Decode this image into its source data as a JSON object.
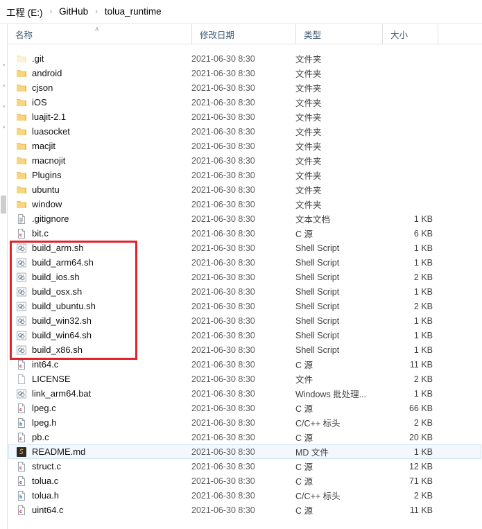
{
  "window": {
    "app": "windows-file-explorer",
    "accent_selection": "#f2f8fd",
    "annotation_color": "#e0232b"
  },
  "breadcrumb": {
    "name": "address-breadcrumb",
    "separator": "›",
    "items": [
      {
        "label": "工程 (E:)"
      },
      {
        "label": "GitHub"
      },
      {
        "label": "tolua_runtime"
      }
    ]
  },
  "columns": {
    "name": "名称",
    "date_modified": "修改日期",
    "type": "类型",
    "size": "大小",
    "sort_indicator": "∧",
    "sort_column": "名称",
    "sort_direction": "ascending"
  },
  "annotation": {
    "shape": "rectangle",
    "color": "#e0232b",
    "targets": [
      "build_arm.sh",
      "build_arm64.sh",
      "build_ios.sh",
      "build_osx.sh",
      "build_ubuntu.sh",
      "build_win32.sh",
      "build_win64.sh",
      "build_x86.sh"
    ]
  },
  "files": [
    {
      "name": ".git",
      "date": "2021-06-30 8:30",
      "type": "文件夹",
      "size": "",
      "icon": "folder-faded-icon",
      "selected": false
    },
    {
      "name": "android",
      "date": "2021-06-30 8:30",
      "type": "文件夹",
      "size": "",
      "icon": "folder-icon",
      "selected": false
    },
    {
      "name": "cjson",
      "date": "2021-06-30 8:30",
      "type": "文件夹",
      "size": "",
      "icon": "folder-icon",
      "selected": false
    },
    {
      "name": "iOS",
      "date": "2021-06-30 8:30",
      "type": "文件夹",
      "size": "",
      "icon": "folder-icon",
      "selected": false
    },
    {
      "name": "luajit-2.1",
      "date": "2021-06-30 8:30",
      "type": "文件夹",
      "size": "",
      "icon": "folder-icon",
      "selected": false
    },
    {
      "name": "luasocket",
      "date": "2021-06-30 8:30",
      "type": "文件夹",
      "size": "",
      "icon": "folder-icon",
      "selected": false
    },
    {
      "name": "macjit",
      "date": "2021-06-30 8:30",
      "type": "文件夹",
      "size": "",
      "icon": "folder-icon",
      "selected": false
    },
    {
      "name": "macnojit",
      "date": "2021-06-30 8:30",
      "type": "文件夹",
      "size": "",
      "icon": "folder-icon",
      "selected": false
    },
    {
      "name": "Plugins",
      "date": "2021-06-30 8:30",
      "type": "文件夹",
      "size": "",
      "icon": "folder-icon",
      "selected": false
    },
    {
      "name": "ubuntu",
      "date": "2021-06-30 8:30",
      "type": "文件夹",
      "size": "",
      "icon": "folder-icon",
      "selected": false
    },
    {
      "name": "window",
      "date": "2021-06-30 8:30",
      "type": "文件夹",
      "size": "",
      "icon": "folder-icon",
      "selected": false
    },
    {
      "name": ".gitignore",
      "date": "2021-06-30 8:30",
      "type": "文本文档",
      "size": "1 KB",
      "icon": "text-document-icon",
      "selected": false
    },
    {
      "name": "bit.c",
      "date": "2021-06-30 8:30",
      "type": "C 源",
      "size": "6 KB",
      "icon": "c-source-icon",
      "selected": false
    },
    {
      "name": "build_arm.sh",
      "date": "2021-06-30 8:30",
      "type": "Shell Script",
      "size": "1 KB",
      "icon": "shell-script-icon",
      "selected": false
    },
    {
      "name": "build_arm64.sh",
      "date": "2021-06-30 8:30",
      "type": "Shell Script",
      "size": "1 KB",
      "icon": "shell-script-icon",
      "selected": false
    },
    {
      "name": "build_ios.sh",
      "date": "2021-06-30 8:30",
      "type": "Shell Script",
      "size": "2 KB",
      "icon": "shell-script-icon",
      "selected": false
    },
    {
      "name": "build_osx.sh",
      "date": "2021-06-30 8:30",
      "type": "Shell Script",
      "size": "1 KB",
      "icon": "shell-script-icon",
      "selected": false
    },
    {
      "name": "build_ubuntu.sh",
      "date": "2021-06-30 8:30",
      "type": "Shell Script",
      "size": "2 KB",
      "icon": "shell-script-icon",
      "selected": false
    },
    {
      "name": "build_win32.sh",
      "date": "2021-06-30 8:30",
      "type": "Shell Script",
      "size": "1 KB",
      "icon": "shell-script-icon",
      "selected": false
    },
    {
      "name": "build_win64.sh",
      "date": "2021-06-30 8:30",
      "type": "Shell Script",
      "size": "1 KB",
      "icon": "shell-script-icon",
      "selected": false
    },
    {
      "name": "build_x86.sh",
      "date": "2021-06-30 8:30",
      "type": "Shell Script",
      "size": "1 KB",
      "icon": "shell-script-icon",
      "selected": false
    },
    {
      "name": "int64.c",
      "date": "2021-06-30 8:30",
      "type": "C 源",
      "size": "11 KB",
      "icon": "c-source-icon",
      "selected": false
    },
    {
      "name": "LICENSE",
      "date": "2021-06-30 8:30",
      "type": "文件",
      "size": "2 KB",
      "icon": "blank-file-icon",
      "selected": false
    },
    {
      "name": "link_arm64.bat",
      "date": "2021-06-30 8:30",
      "type": "Windows 批处理...",
      "size": "1 KB",
      "icon": "shell-script-icon",
      "selected": false
    },
    {
      "name": "lpeg.c",
      "date": "2021-06-30 8:30",
      "type": "C 源",
      "size": "66 KB",
      "icon": "c-source-icon",
      "selected": false
    },
    {
      "name": "lpeg.h",
      "date": "2021-06-30 8:30",
      "type": "C/C++ 标头",
      "size": "2 KB",
      "icon": "h-header-icon",
      "selected": false
    },
    {
      "name": "pb.c",
      "date": "2021-06-30 8:30",
      "type": "C 源",
      "size": "20 KB",
      "icon": "c-source-icon",
      "selected": false
    },
    {
      "name": "README.md",
      "date": "2021-06-30 8:30",
      "type": "MD 文件",
      "size": "1 KB",
      "icon": "markdown-typora-icon",
      "selected": true
    },
    {
      "name": "struct.c",
      "date": "2021-06-30 8:30",
      "type": "C 源",
      "size": "12 KB",
      "icon": "c-source-icon",
      "selected": false
    },
    {
      "name": "tolua.c",
      "date": "2021-06-30 8:30",
      "type": "C 源",
      "size": "71 KB",
      "icon": "c-source-icon",
      "selected": false
    },
    {
      "name": "tolua.h",
      "date": "2021-06-30 8:30",
      "type": "C/C++ 标头",
      "size": "2 KB",
      "icon": "h-header-icon",
      "selected": false
    },
    {
      "name": "uint64.c",
      "date": "2021-06-30 8:30",
      "type": "C 源",
      "size": "11 KB",
      "icon": "c-source-icon",
      "selected": false
    }
  ]
}
